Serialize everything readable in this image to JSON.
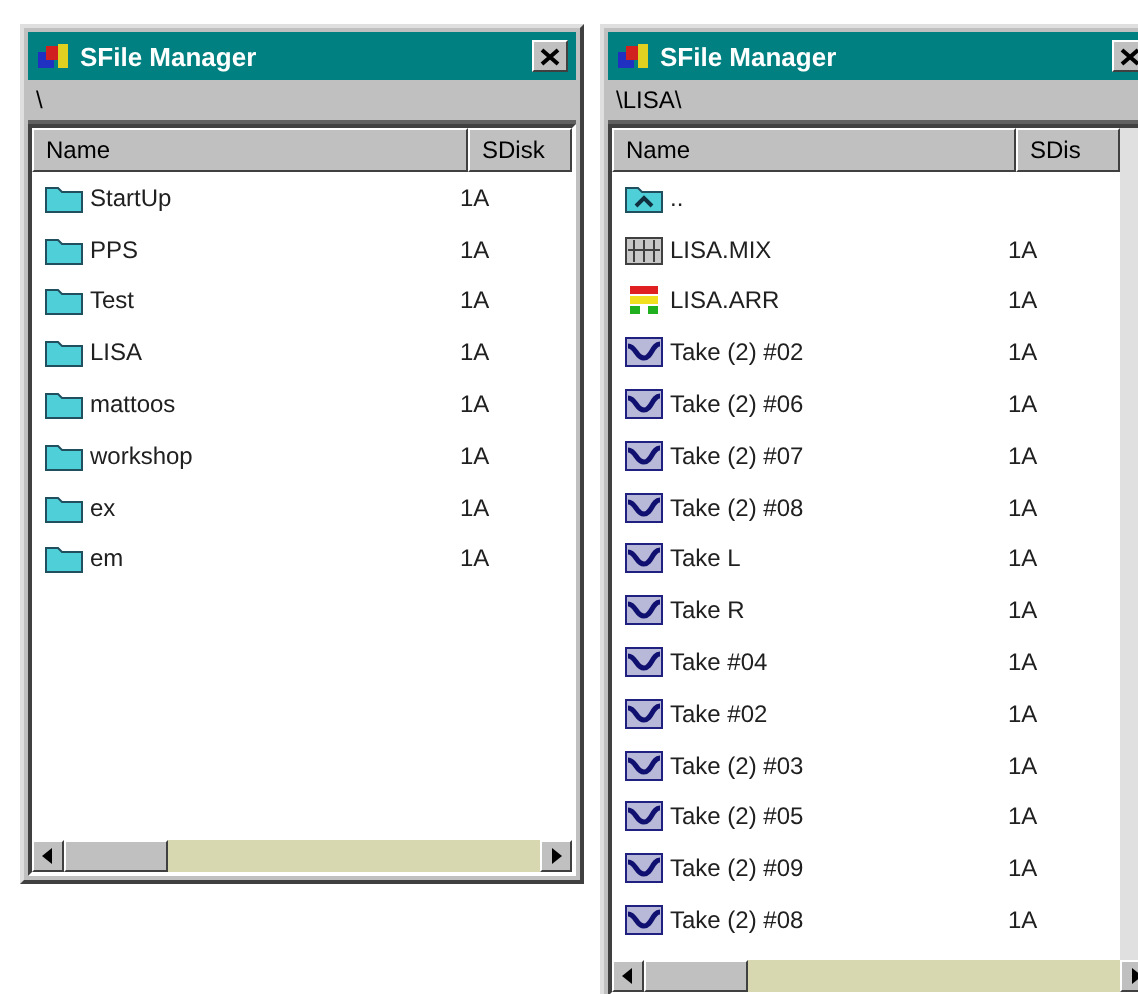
{
  "windows": [
    {
      "title": "SFile Manager",
      "path": "\\",
      "columns": [
        "Name",
        "SDisk"
      ],
      "rows": [
        {
          "kind": "folder",
          "name": "StartUp",
          "disk": "1A"
        },
        {
          "kind": "folder",
          "name": "PPS",
          "disk": "1A"
        },
        {
          "kind": "folder",
          "name": "Test",
          "disk": "1A"
        },
        {
          "kind": "folder",
          "name": "LISA",
          "disk": "1A"
        },
        {
          "kind": "folder",
          "name": "mattoos",
          "disk": "1A"
        },
        {
          "kind": "folder",
          "name": "workshop",
          "disk": "1A"
        },
        {
          "kind": "folder",
          "name": "ex",
          "disk": "1A"
        },
        {
          "kind": "folder",
          "name": "em",
          "disk": "1A"
        }
      ]
    },
    {
      "title": "SFile Manager",
      "path": "\\LISA\\",
      "columns": [
        "Name",
        "SDis"
      ],
      "rows": [
        {
          "kind": "parent",
          "name": ".."
        },
        {
          "kind": "mix",
          "name": "LISA.MIX",
          "disk": "1A"
        },
        {
          "kind": "arrange",
          "name": "LISA.ARR",
          "disk": "1A"
        },
        {
          "kind": "wave",
          "name": "Take (2) #02",
          "disk": "1A"
        },
        {
          "kind": "wave",
          "name": "Take (2) #06",
          "disk": "1A"
        },
        {
          "kind": "wave",
          "name": "Take (2) #07",
          "disk": "1A"
        },
        {
          "kind": "wave",
          "name": "Take (2) #08",
          "disk": "1A"
        },
        {
          "kind": "wave",
          "name": "Take L",
          "disk": "1A"
        },
        {
          "kind": "wave",
          "name": "Take R",
          "disk": "1A"
        },
        {
          "kind": "wave",
          "name": "Take #04",
          "disk": "1A"
        },
        {
          "kind": "wave",
          "name": "Take #02",
          "disk": "1A"
        },
        {
          "kind": "wave",
          "name": "Take (2) #03",
          "disk": "1A"
        },
        {
          "kind": "wave",
          "name": "Take (2) #05",
          "disk": "1A"
        },
        {
          "kind": "wave",
          "name": "Take (2) #09",
          "disk": "1A"
        },
        {
          "kind": "wave",
          "name": "Take (2) #08",
          "disk": "1A"
        }
      ]
    }
  ]
}
